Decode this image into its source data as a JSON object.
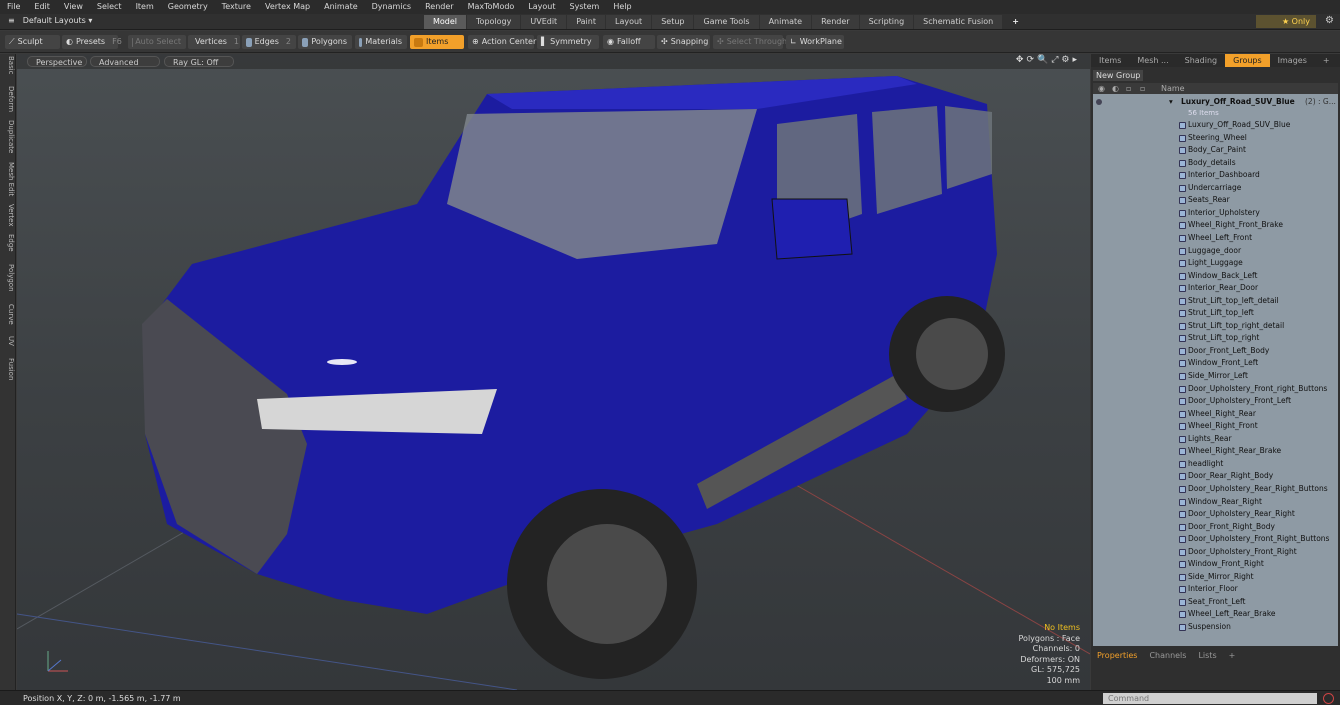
{
  "menu": [
    "File",
    "Edit",
    "View",
    "Select",
    "Item",
    "Geometry",
    "Texture",
    "Vertex Map",
    "Animate",
    "Dynamics",
    "Render",
    "MaxToModo",
    "Layout",
    "System",
    "Help"
  ],
  "layouts_label": "Default Layouts ▾",
  "layout_tabs": [
    "Model",
    "Topology",
    "UVEdit",
    "Paint",
    "Layout",
    "Setup",
    "Game Tools",
    "Animate",
    "Render",
    "Scripting",
    "Schematic Fusion",
    "+"
  ],
  "only_label": "Only",
  "toolbar": {
    "sculpt": "Sculpt",
    "presets": "Presets",
    "presets_key": "F6",
    "auto_select": "Auto Select",
    "vertices": "Vertices",
    "vertices_key": "1",
    "edges": "Edges",
    "edges_key": "2",
    "polygons": "Polygons",
    "materials": "Materials",
    "items": "Items",
    "action_center": "Action Center",
    "symmetry": "Symmetry",
    "falloff": "Falloff",
    "snapping": "Snapping",
    "select_through": "Select Through",
    "workplane": "WorkPlane"
  },
  "left_tabs": [
    "Basic",
    "Deform",
    "Duplicate",
    "Mesh Edit",
    "Vertex",
    "Edge",
    "Polygon",
    "Curve",
    "UV",
    "Fusion"
  ],
  "viewport": {
    "view": "Perspective",
    "mode": "Advanced",
    "raygl": "Ray GL: Off",
    "info": {
      "no_items": "No Items",
      "polygons": "Polygons : Face",
      "channels": "Channels: 0",
      "deformers": "Deformers: ON",
      "gl": "GL: 575,725",
      "scale": "100 mm"
    }
  },
  "right_tabs": [
    "Items",
    "Mesh ...",
    "Shading",
    "Groups",
    "Images",
    "+"
  ],
  "new_group": "New Group",
  "list_header": "Name",
  "root_group": "Luxury_Off_Road_SUV_Blue",
  "root_count": "(2) : G...",
  "sub_count": "56 Items",
  "items": [
    "Luxury_Off_Road_SUV_Blue",
    "Steering_Wheel",
    "Body_Car_Paint",
    "Body_details",
    "Interior_Dashboard",
    "Undercarriage",
    "Seats_Rear",
    "Interior_Upholstery",
    "Wheel_Right_Front_Brake",
    "Wheel_Left_Front",
    "Luggage_door",
    "Light_Luggage",
    "Window_Back_Left",
    "Interior_Rear_Door",
    "Strut_Lift_top_left_detail",
    "Strut_Lift_top_left",
    "Strut_Lift_top_right_detail",
    "Strut_Lift_top_right",
    "Door_Front_Left_Body",
    "Window_Front_Left",
    "Side_Mirror_Left",
    "Door_Upholstery_Front_right_Buttons",
    "Door_Upholstery_Front_Left",
    "Wheel_Right_Rear",
    "Wheel_Right_Front",
    "Lights_Rear",
    "Wheel_Right_Rear_Brake",
    "headlight",
    "Door_Rear_Right_Body",
    "Door_Upholstery_Rear_Right_Buttons",
    "Window_Rear_Right",
    "Door_Upholstery_Rear_Right",
    "Door_Front_Right_Body",
    "Door_Upholstery_Front_Right_Buttons",
    "Door_Upholstery_Front_Right",
    "Window_Front_Right",
    "Side_Mirror_Right",
    "Interior_Floor",
    "Seat_Front_Left",
    "Wheel_Left_Rear_Brake",
    "Suspension"
  ],
  "lower_tabs": [
    "Properties",
    "Channels",
    "Lists",
    "+"
  ],
  "status_position": "Position X, Y, Z:  0 m, -1.565 m, -1.77 m",
  "command_placeholder": "Command",
  "colors": {
    "accent": "#f2a02a",
    "car_body": "#1f1fa8",
    "list_bg": "#8e9aa4"
  }
}
